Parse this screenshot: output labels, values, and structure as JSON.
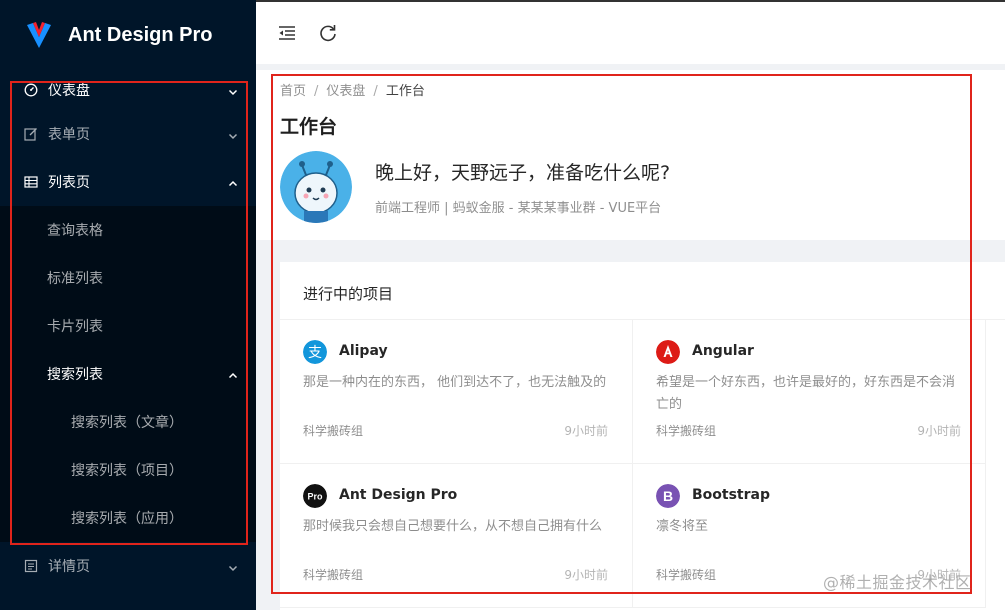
{
  "app": {
    "title": "Ant Design Pro",
    "accent": "#1890ff",
    "sidebar_bg": "#001529"
  },
  "sidebar": {
    "dashboard": {
      "label": "仪表盘",
      "icon": "dashboard-icon"
    },
    "form": {
      "label": "表单页",
      "icon": "edit-icon"
    },
    "list": {
      "label": "列表页",
      "icon": "table-icon",
      "children": [
        {
          "label": "查询表格"
        },
        {
          "label": "标准列表"
        },
        {
          "label": "卡片列表"
        },
        {
          "label": "搜索列表",
          "children": [
            {
              "label": "搜索列表（文章）"
            },
            {
              "label": "搜索列表（项目）"
            },
            {
              "label": "搜索列表（应用）"
            }
          ]
        }
      ]
    },
    "profile": {
      "label": "详情页",
      "icon": "profile-icon"
    }
  },
  "header": {
    "collapse_icon": "menu-fold-icon",
    "reload_icon": "reload-icon"
  },
  "breadcrumb": [
    "首页",
    "仪表盘",
    "工作台"
  ],
  "page": {
    "title": "工作台",
    "greeting": "晚上好，天野远子，准备吃什么呢?",
    "subtitle": "前端工程师 | 蚂蚁金服 - 某某某事业群 - VUE平台"
  },
  "projects": {
    "title": "进行中的项目",
    "items": [
      {
        "name": "Alipay",
        "desc": "那是一种内在的东西， 他们到达不了，也无法触及的",
        "team": "科学搬砖组",
        "time": "9小时前",
        "logo": "alipay-logo",
        "color": "#1296db"
      },
      {
        "name": "Angular",
        "desc": "希望是一个好东西，也许是最好的，好东西是不会消亡的",
        "team": "科学搬砖组",
        "time": "9小时前",
        "logo": "angular-logo",
        "color": "#dd1b16"
      },
      {
        "name": "Ant Design Pro",
        "desc": "那时候我只会想自己想要什么，从不想自己拥有什么",
        "team": "科学搬砖组",
        "time": "9小时前",
        "logo": "ant-design-pro-logo",
        "color": "#111111"
      },
      {
        "name": "Bootstrap",
        "desc": "凛冬将至",
        "team": "科学搬砖组",
        "time": "9小时前",
        "logo": "bootstrap-logo",
        "color": "#7952b3"
      }
    ]
  },
  "watermark": "@稀土掘金技术社区"
}
